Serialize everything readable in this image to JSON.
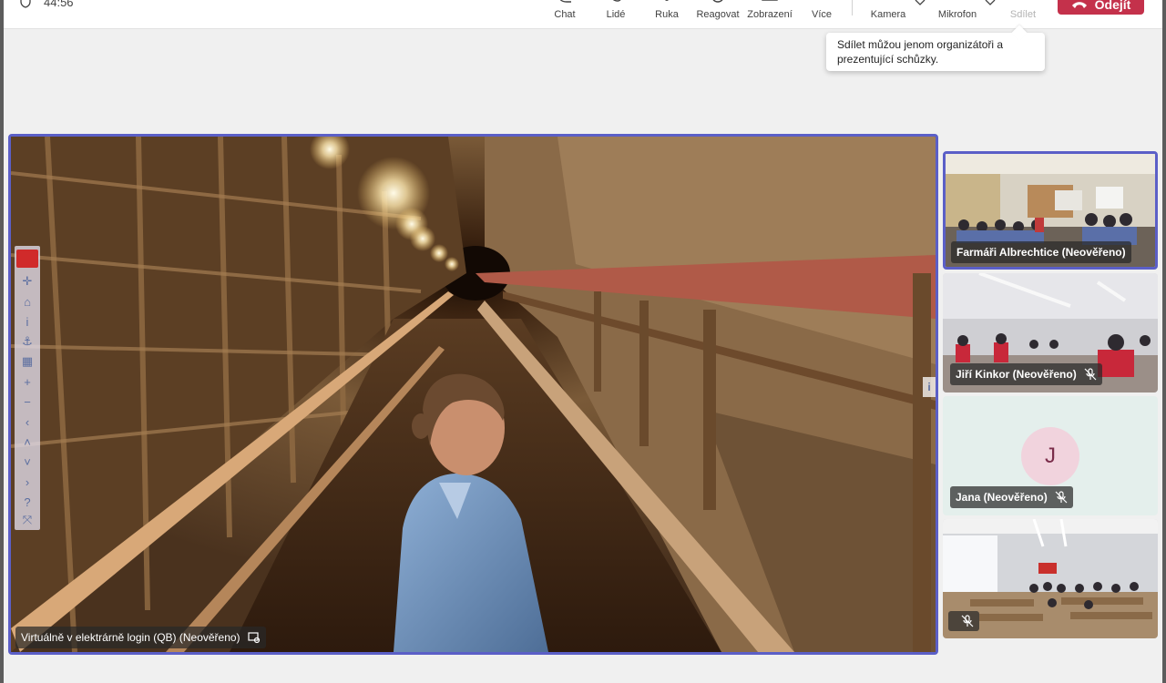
{
  "toolbar": {
    "timer": "44:56",
    "items": [
      {
        "label": "Chat",
        "icon": "chat-icon"
      },
      {
        "label": "Lidé",
        "icon": "people-icon"
      },
      {
        "label": "Ruka",
        "icon": "raise-hand-icon"
      },
      {
        "label": "Reagovat",
        "icon": "react-icon"
      },
      {
        "label": "Zobrazení",
        "icon": "view-icon"
      },
      {
        "label": "Více",
        "icon": "more-icon"
      },
      {
        "label": "Kamera",
        "icon": "camera-icon"
      },
      {
        "label": "Mikrofon",
        "icon": "microphone-icon"
      },
      {
        "label": "Sdílet",
        "icon": "share-icon",
        "disabled": true
      }
    ],
    "leave_label": "Odejít"
  },
  "tooltip": {
    "text": "Sdílet můžou jenom organizátoři a prezentující schůzky."
  },
  "main_video": {
    "participant": "Virtuálně v elektrárně login (QB) (Neověřeno)"
  },
  "map_toolbar": {
    "buttons": [
      "✛",
      "⌂",
      "i",
      "⚓",
      "▦",
      "+",
      "−",
      "‹",
      "˄",
      "˅",
      "›",
      "?",
      "⤧"
    ]
  },
  "tiles": [
    {
      "name": "Farmáři Albrechtice (Neověřeno)",
      "muted": false,
      "active": true
    },
    {
      "name": "Jiří Kinkor (Neověřeno)",
      "muted": true
    },
    {
      "name": "Jana (Neověřeno)",
      "muted": true,
      "avatar_initial": "J"
    },
    {
      "name": "",
      "muted": true
    }
  ],
  "colors": {
    "accent": "#5b5fc7",
    "leave": "#c4314b",
    "avatar_bg": "#f1d3dd"
  }
}
